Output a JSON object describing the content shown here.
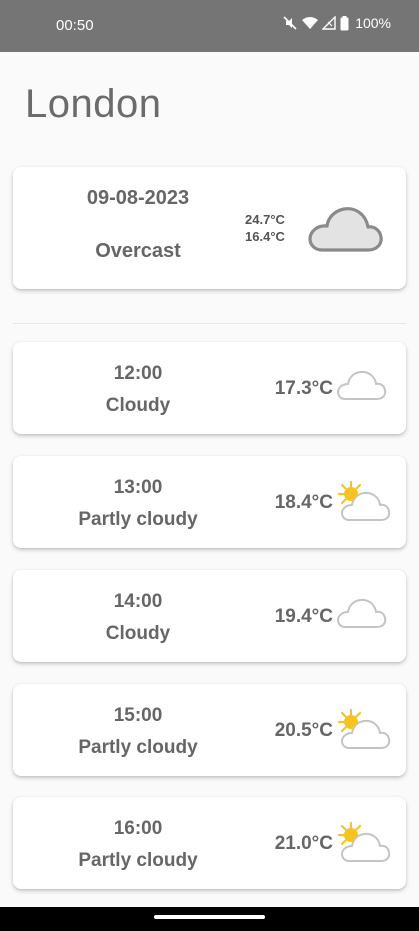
{
  "status_bar": {
    "time": "00:50",
    "battery": "100%"
  },
  "city": "London",
  "summary": {
    "date": "09-08-2023",
    "condition": "Overcast",
    "max_temp": "24.7°C",
    "min_temp": "16.4°C",
    "icon": "overcast-cloud-icon"
  },
  "hourly": [
    {
      "time": "12:00",
      "condition": "Cloudy",
      "temp": "17.3°C",
      "icon": "cloud-outline-icon"
    },
    {
      "time": "13:00",
      "condition": "Partly cloudy",
      "temp": "18.4°C",
      "icon": "sun-cloud-icon"
    },
    {
      "time": "14:00",
      "condition": "Cloudy",
      "temp": "19.4°C",
      "icon": "cloud-outline-icon"
    },
    {
      "time": "15:00",
      "condition": "Partly cloudy",
      "temp": "20.5°C",
      "icon": "sun-cloud-icon"
    },
    {
      "time": "16:00",
      "condition": "Partly cloudy",
      "temp": "21.0°C",
      "icon": "sun-cloud-icon"
    }
  ],
  "colors": {
    "status_bar": "#757575",
    "sun": "#f7c322",
    "cloud_stroke": "#bdbdbd",
    "text": "#666666"
  }
}
